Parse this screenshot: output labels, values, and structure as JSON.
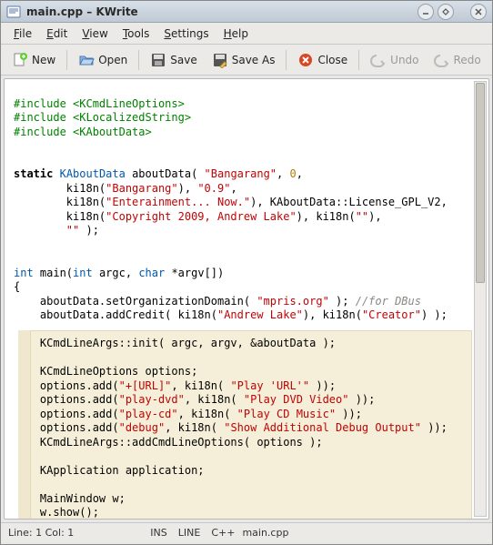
{
  "window": {
    "title": "main.cpp – KWrite"
  },
  "menu": {
    "file": "File",
    "edit": "Edit",
    "view": "View",
    "tools": "Tools",
    "settings": "Settings",
    "help": "Help"
  },
  "toolbar": {
    "new": "New",
    "open": "Open",
    "save": "Save",
    "saveas": "Save As",
    "close": "Close",
    "undo": "Undo",
    "redo": "Redo"
  },
  "status": {
    "lineCol": "Line: 1 Col: 1",
    "ins": "INS",
    "wrap": "LINE",
    "lang": "C++",
    "file": "main.cpp"
  },
  "code": {
    "inc1": "#include <KCmdLineOptions>",
    "inc2": "#include <KLocalizedString>",
    "inc3": "#include <KAboutData>",
    "static": "static",
    "type_about": "KAboutData",
    "var_about": " aboutData( ",
    "s_bang": "\"Bangarang\"",
    "comma0": ", ",
    "zero": "0",
    "comma0b": ",",
    "ki18n": "ki18n(",
    "s_bang2": "\"Bangarang\"",
    "close_s": "), ",
    "s_ver": "\"0.9\"",
    "comma1": ",",
    "s_ent": "\"Enterainment... Now.\"",
    "close1": "), KAboutData::License_GPL_V2,",
    "s_cpy": "\"Copyright 2009, Andrew Lake\"",
    "close2": "), ki18n(",
    "s_empty": "\"\"",
    "close3": "),",
    "s_empty2": "\"\"",
    "close4": " );",
    "int": "int",
    "main": " main(",
    "int2": "int",
    "argc": " argc, ",
    "char": "char",
    "argv": " *argv[])",
    "brace_o": "{",
    "l1a": "aboutData.setOrganizationDomain( ",
    "l1s": "\"mpris.org\"",
    "l1b": " ); ",
    "l1c": "//for DBus",
    "l2a": "aboutData.addCredit( ki18n(",
    "l2s1": "\"Andrew Lake\"",
    "l2b": "), ki18n(",
    "l2s2": "\"Creator\"",
    "l2c": ") );",
    "l3": "KCmdLineArgs::init( argc, argv, &aboutData );",
    "l4": "KCmdLineOptions options;",
    "l5a": "options.add(",
    "l5s1": "\"+[URL]\"",
    "l5b": ", ki18n( ",
    "l5s2": "\"Play 'URL'\"",
    "l5c": " ));",
    "l6a": "options.add(",
    "l6s1": "\"play-dvd\"",
    "l6b": ", ki18n( ",
    "l6s2": "\"Play DVD Video\"",
    "l6c": " ));",
    "l7a": "options.add(",
    "l7s1": "\"play-cd\"",
    "l7b": ", ki18n( ",
    "l7s2": "\"Play CD Music\"",
    "l7c": " ));",
    "l8a": "options.add(",
    "l8s1": "\"debug\"",
    "l8b": ", ki18n( ",
    "l8s2": "\"Show Additional Debug Output\"",
    "l8c": " ));",
    "l9": "KCmdLineArgs::addCmdLineOptions( options );",
    "l10": "KApplication application;",
    "l11": "MainWindow w;",
    "l12": "w.show();"
  }
}
